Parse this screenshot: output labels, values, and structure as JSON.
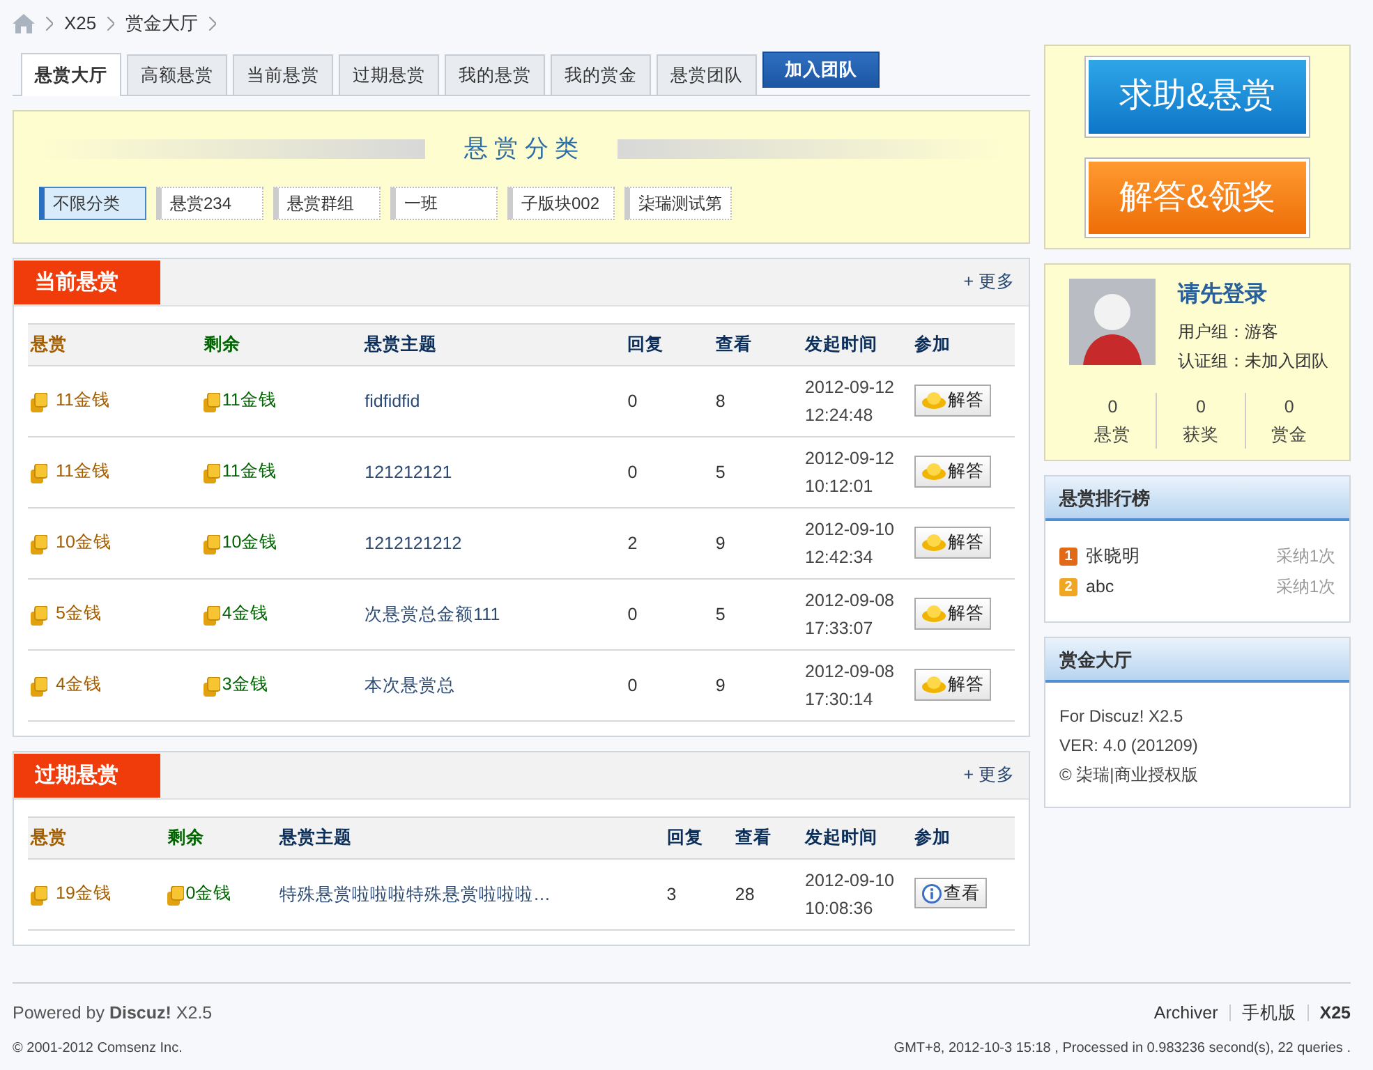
{
  "breadcrumb": [
    "X25",
    "赏金大厅"
  ],
  "tabs": [
    {
      "label": "悬赏大厅",
      "selected": true,
      "kind": "tab"
    },
    {
      "label": "高额悬赏",
      "selected": false,
      "kind": "tab"
    },
    {
      "label": "当前悬赏",
      "selected": false,
      "kind": "tab"
    },
    {
      "label": "过期悬赏",
      "selected": false,
      "kind": "tab"
    },
    {
      "label": "我的悬赏",
      "selected": false,
      "kind": "tab"
    },
    {
      "label": "我的赏金",
      "selected": false,
      "kind": "tab"
    },
    {
      "label": "悬赏团队",
      "selected": false,
      "kind": "tab"
    },
    {
      "label": "加入团队",
      "kind": "action"
    }
  ],
  "category": {
    "title": "悬 赏 分 类",
    "items": [
      {
        "label": "不限分类",
        "selected": true
      },
      {
        "label": "悬赏234",
        "selected": false
      },
      {
        "label": "悬赏群组",
        "selected": false
      },
      {
        "label": "一班",
        "selected": false
      },
      {
        "label": "子版块002",
        "selected": false
      },
      {
        "label": "柒瑞测试第",
        "selected": false
      }
    ]
  },
  "panels": [
    {
      "title": "当前悬赏",
      "more": "+ 更多",
      "columns": [
        {
          "label": "悬赏",
          "color": "#a25d00"
        },
        {
          "label": "剩余",
          "color": "#006400"
        },
        {
          "label": "悬赏主题",
          "color": "#0b2f5a"
        },
        {
          "label": "回复",
          "color": "#0b2f5a"
        },
        {
          "label": "查看",
          "color": "#0b2f5a"
        },
        {
          "label": "发起时间",
          "color": "#0b2f5a"
        },
        {
          "label": "参加",
          "color": "#0b2f5a"
        }
      ],
      "rows": [
        {
          "reward": "11金钱",
          "remaining": "11金钱",
          "subject": "fidfidfid",
          "replies": "0",
          "views": "8",
          "date": "2012-09-12",
          "time": "12:24:48",
          "action": {
            "label": "解答",
            "kind": "answer"
          }
        },
        {
          "reward": "11金钱",
          "remaining": "11金钱",
          "subject": "121212121",
          "replies": "0",
          "views": "5",
          "date": "2012-09-12",
          "time": "10:12:01",
          "action": {
            "label": "解答",
            "kind": "answer"
          }
        },
        {
          "reward": "10金钱",
          "remaining": "10金钱",
          "subject": "1212121212",
          "replies": "2",
          "views": "9",
          "date": "2012-09-10",
          "time": "12:42:34",
          "action": {
            "label": "解答",
            "kind": "answer"
          }
        },
        {
          "reward": "5金钱",
          "remaining": "4金钱",
          "subject": "次悬赏总金额111",
          "replies": "0",
          "views": "5",
          "date": "2012-09-08",
          "time": "17:33:07",
          "action": {
            "label": "解答",
            "kind": "answer"
          }
        },
        {
          "reward": "4金钱",
          "remaining": "3金钱",
          "subject": "本次悬赏总",
          "replies": "0",
          "views": "9",
          "date": "2012-09-08",
          "time": "17:30:14",
          "action": {
            "label": "解答",
            "kind": "answer"
          }
        }
      ]
    },
    {
      "title": "过期悬赏",
      "more": "+ 更多",
      "columns": [
        {
          "label": "悬赏",
          "color": "#a25d00"
        },
        {
          "label": "剩余",
          "color": "#006400"
        },
        {
          "label": "悬赏主题",
          "color": "#0b2f5a"
        },
        {
          "label": "回复",
          "color": "#0b2f5a"
        },
        {
          "label": "查看",
          "color": "#0b2f5a"
        },
        {
          "label": "发起时间",
          "color": "#0b2f5a"
        },
        {
          "label": "参加",
          "color": "#0b2f5a"
        }
      ],
      "rows": [
        {
          "reward": "19金钱",
          "remaining": "0金钱",
          "subject": "特殊悬赏啦啦啦特殊悬赏啦啦啦…",
          "replies": "3",
          "views": "28",
          "date": "2012-09-10",
          "time": "10:08:36",
          "action": {
            "label": "查看",
            "kind": "view"
          }
        }
      ]
    }
  ],
  "sidebar": {
    "actions": [
      {
        "label": "求助&悬赏",
        "kind": "help"
      },
      {
        "label": "解答&领奖",
        "kind": "answer"
      }
    ],
    "user": {
      "name": "请先登录",
      "group": "用户组：游客",
      "cert": "认证组：未加入团队",
      "stats": [
        {
          "value": "0",
          "label": "悬赏"
        },
        {
          "value": "0",
          "label": "获奖"
        },
        {
          "value": "0",
          "label": "赏金"
        }
      ]
    },
    "ranking": {
      "title": "悬赏排行榜",
      "items": [
        {
          "rank": "1",
          "name": "张晓明",
          "count": "采纳1次",
          "color": "#e06a17"
        },
        {
          "rank": "2",
          "name": "abc",
          "count": "采纳1次",
          "color": "#f0a625"
        }
      ]
    },
    "about": {
      "title": "赏金大厅",
      "lines": [
        "For Discuz! X2.5",
        "VER: 4.0 (201209)",
        "© 柒瑞|商业授权版"
      ]
    }
  },
  "footer": {
    "powered": "Powered by **Discuz!** X2.5",
    "copyright": "© 2001-2012 Comsenz Inc.",
    "links": [
      {
        "label": "Archiver",
        "bold": false
      },
      {
        "label": "手机版",
        "bold": false
      },
      {
        "label": "X25",
        "bold": true
      }
    ],
    "stats": "GMT+8, 2012-10-3 15:18 , Processed in 0.983236 second(s), 22 queries ."
  }
}
